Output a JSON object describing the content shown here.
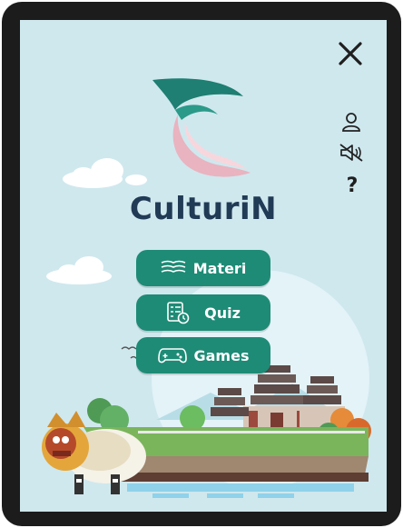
{
  "app": {
    "name": "CulturiN"
  },
  "menu": {
    "items": [
      {
        "label": "Materi",
        "icon": "book-icon"
      },
      {
        "label": "Quiz",
        "icon": "quiz-icon"
      },
      {
        "label": "Games",
        "icon": "gamepad-icon"
      }
    ]
  },
  "side_controls": {
    "close_icon": "close-icon",
    "profile_icon": "user-icon",
    "mute_icon": "sound-muted-icon",
    "help_label": "?"
  },
  "colors": {
    "screen_bg": "#cfe8ee",
    "button": "#1e8b76",
    "brand_text": "#213a55",
    "logo_teal": "#1e7f72",
    "logo_pink": "#e9b3bf"
  }
}
